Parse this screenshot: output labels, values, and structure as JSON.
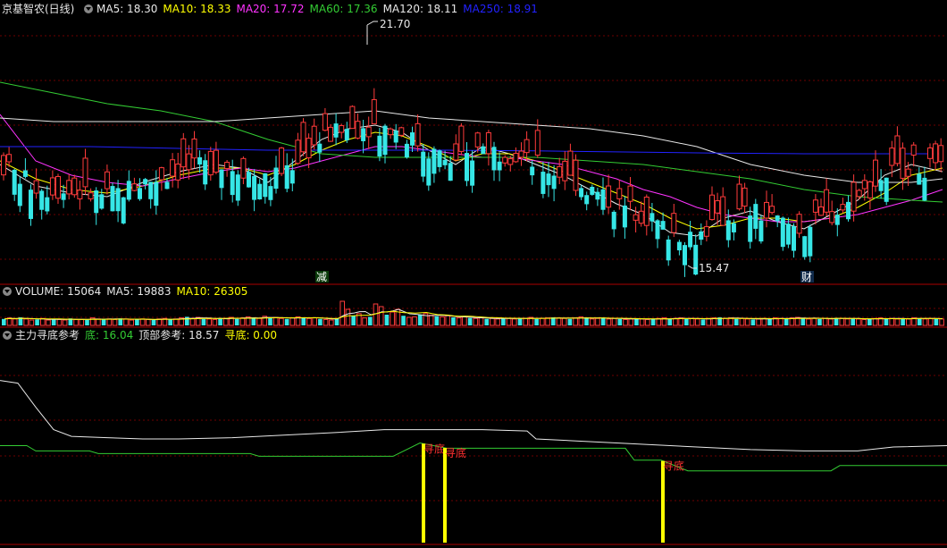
{
  "colors": {
    "background": "#000000",
    "frame": "#aa0000",
    "grid": "#6e0000",
    "up": "#ff3b3b",
    "down": "#36e6e6",
    "white_line": "#e8e8e8",
    "yellow": "#ffff00",
    "magenta": "#ff33ff",
    "green": "#33cc33",
    "blue": "#2222ff",
    "label_text": "#e8e8e8"
  },
  "price_panel": {
    "stock_name": "京基智农(日线)",
    "indicators": [
      {
        "label": "MA5: 18.30",
        "color": "#e8e8e8"
      },
      {
        "label": "MA10: 18.33",
        "color": "#ffff00"
      },
      {
        "label": "MA20: 17.72",
        "color": "#ff33ff"
      },
      {
        "label": "MA60: 17.36",
        "color": "#33cc33"
      },
      {
        "label": "MA120: 18.11",
        "color": "#e8e8e8"
      },
      {
        "label": "MA250: 18.91",
        "color": "#2222ff"
      }
    ],
    "high_label": "21.70",
    "low_label": "15.47",
    "marker_jian": "减",
    "marker_cai": "财"
  },
  "volume_panel": {
    "indicators": [
      {
        "label": "VOLUME: 15064",
        "color": "#e8e8e8"
      },
      {
        "label": "MA5: 19883",
        "color": "#e8e8e8"
      },
      {
        "label": "MA10: 26305",
        "color": "#ffff00"
      }
    ]
  },
  "indicator_panel": {
    "title": "主力寻底参考",
    "indicators": [
      {
        "label": "底: 16.04",
        "color": "#33cc33"
      },
      {
        "label": "顶部参考: 18.57",
        "color": "#e8e8e8"
      },
      {
        "label": "寻底: 0.00",
        "color": "#ffff00"
      }
    ],
    "signal_text": "寻底",
    "signals": [
      {
        "x": 474,
        "label": "寻底"
      },
      {
        "x": 498,
        "label": "寻底"
      },
      {
        "x": 742,
        "label": "寻底"
      }
    ]
  },
  "chart_data": [
    {
      "type": "candlestick",
      "ylim": [
        15.0,
        22.0
      ],
      "series": [
        {
          "name": "MA5",
          "color": "#e8e8e8",
          "points": [
            [
              0,
              17.9
            ],
            [
              40,
              17.3
            ],
            [
              80,
              17.1
            ],
            [
              120,
              17.0
            ],
            [
              160,
              17.4
            ],
            [
              200,
              17.7
            ],
            [
              240,
              17.9
            ],
            [
              270,
              17.8
            ],
            [
              300,
              17.4
            ],
            [
              330,
              18.0
            ],
            [
              360,
              18.6
            ],
            [
              390,
              18.9
            ],
            [
              420,
              19.0
            ],
            [
              450,
              18.8
            ],
            [
              480,
              18.3
            ],
            [
              510,
              17.9
            ],
            [
              540,
              18.4
            ],
            [
              570,
              18.2
            ],
            [
              600,
              17.9
            ],
            [
              630,
              17.6
            ],
            [
              660,
              17.2
            ],
            [
              690,
              16.8
            ],
            [
              720,
              16.5
            ],
            [
              750,
              16.0
            ],
            [
              780,
              15.9
            ],
            [
              810,
              16.4
            ],
            [
              840,
              16.6
            ],
            [
              870,
              16.3
            ],
            [
              900,
              16.1
            ],
            [
              930,
              16.5
            ],
            [
              960,
              16.9
            ],
            [
              990,
              17.6
            ],
            [
              1020,
              17.9
            ],
            [
              1055,
              17.7
            ]
          ]
        },
        {
          "name": "MA10",
          "color": "#ffff00",
          "points": [
            [
              0,
              18.0
            ],
            [
              40,
              17.5
            ],
            [
              80,
              17.2
            ],
            [
              120,
              17.1
            ],
            [
              160,
              17.3
            ],
            [
              200,
              17.6
            ],
            [
              240,
              17.8
            ],
            [
              270,
              17.8
            ],
            [
              300,
              17.6
            ],
            [
              330,
              17.9
            ],
            [
              360,
              18.3
            ],
            [
              390,
              18.6
            ],
            [
              420,
              18.8
            ],
            [
              450,
              18.7
            ],
            [
              480,
              18.4
            ],
            [
              510,
              18.0
            ],
            [
              540,
              18.2
            ],
            [
              570,
              18.2
            ],
            [
              600,
              18.0
            ],
            [
              630,
              17.7
            ],
            [
              660,
              17.4
            ],
            [
              690,
              17.1
            ],
            [
              720,
              16.8
            ],
            [
              750,
              16.4
            ],
            [
              780,
              16.1
            ],
            [
              810,
              16.2
            ],
            [
              840,
              16.4
            ],
            [
              870,
              16.4
            ],
            [
              900,
              16.3
            ],
            [
              930,
              16.4
            ],
            [
              960,
              16.7
            ],
            [
              990,
              17.1
            ],
            [
              1020,
              17.6
            ],
            [
              1055,
              17.8
            ]
          ]
        },
        {
          "name": "MA20",
          "color": "#ff33ff",
          "points": [
            [
              0,
              19.3
            ],
            [
              40,
              18.0
            ],
            [
              80,
              17.6
            ],
            [
              120,
              17.4
            ],
            [
              160,
              17.3
            ],
            [
              200,
              17.5
            ],
            [
              240,
              17.7
            ],
            [
              270,
              17.8
            ],
            [
              300,
              17.7
            ],
            [
              330,
              17.8
            ],
            [
              360,
              18.0
            ],
            [
              390,
              18.2
            ],
            [
              420,
              18.4
            ],
            [
              450,
              18.4
            ],
            [
              480,
              18.3
            ],
            [
              510,
              18.2
            ],
            [
              540,
              18.1
            ],
            [
              570,
              18.1
            ],
            [
              600,
              18.0
            ],
            [
              630,
              17.9
            ],
            [
              660,
              17.7
            ],
            [
              690,
              17.5
            ],
            [
              720,
              17.2
            ],
            [
              750,
              17.0
            ],
            [
              780,
              16.7
            ],
            [
              810,
              16.5
            ],
            [
              840,
              16.4
            ],
            [
              870,
              16.3
            ],
            [
              900,
              16.3
            ],
            [
              930,
              16.4
            ],
            [
              960,
              16.5
            ],
            [
              990,
              16.7
            ],
            [
              1020,
              16.9
            ],
            [
              1055,
              17.2
            ]
          ]
        },
        {
          "name": "MA60",
          "color": "#33cc33",
          "points": [
            [
              0,
              20.2
            ],
            [
              60,
              19.9
            ],
            [
              120,
              19.6
            ],
            [
              180,
              19.4
            ],
            [
              240,
              19.1
            ],
            [
              300,
              18.6
            ],
            [
              360,
              18.2
            ],
            [
              420,
              18.1
            ],
            [
              480,
              18.1
            ],
            [
              540,
              18.1
            ],
            [
              600,
              18.1
            ],
            [
              660,
              18.0
            ],
            [
              720,
              17.9
            ],
            [
              780,
              17.7
            ],
            [
              840,
              17.5
            ],
            [
              900,
              17.2
            ],
            [
              960,
              17.0
            ],
            [
              1020,
              16.9
            ],
            [
              1055,
              16.85
            ]
          ]
        },
        {
          "name": "MA120",
          "color": "#e8e8e8",
          "points": [
            [
              0,
              19.2
            ],
            [
              60,
              19.1
            ],
            [
              120,
              19.1
            ],
            [
              180,
              19.1
            ],
            [
              240,
              19.1
            ],
            [
              300,
              19.2
            ],
            [
              360,
              19.3
            ],
            [
              420,
              19.4
            ],
            [
              480,
              19.2
            ],
            [
              540,
              19.1
            ],
            [
              600,
              19.0
            ],
            [
              660,
              18.9
            ],
            [
              720,
              18.7
            ],
            [
              780,
              18.4
            ],
            [
              840,
              17.9
            ],
            [
              900,
              17.6
            ],
            [
              960,
              17.4
            ],
            [
              1020,
              17.4
            ],
            [
              1055,
              17.5
            ]
          ]
        },
        {
          "name": "MA250",
          "color": "#2222ff",
          "points": [
            [
              0,
              18.4
            ],
            [
              100,
              18.4
            ],
            [
              200,
              18.35
            ],
            [
              300,
              18.3
            ],
            [
              400,
              18.3
            ],
            [
              500,
              18.3
            ],
            [
              600,
              18.28
            ],
            [
              700,
              18.25
            ],
            [
              800,
              18.22
            ],
            [
              900,
              18.2
            ],
            [
              1000,
              18.2
            ],
            [
              1055,
              18.2
            ]
          ]
        }
      ],
      "low_index": 26,
      "high_index": 12
    },
    {
      "type": "bar",
      "ylim": [
        0,
        100000
      ],
      "series": [
        {
          "name": "VOLUME",
          "values": [
            12,
            14,
            12,
            15,
            12,
            10,
            11,
            13,
            10,
            12,
            11,
            10,
            13,
            11,
            11,
            10,
            14,
            12,
            11,
            12,
            11,
            13,
            12,
            10,
            11,
            12,
            11,
            10,
            12,
            13,
            11,
            12,
            14,
            16,
            13,
            15,
            12,
            12,
            11,
            14,
            13,
            15,
            12,
            14,
            16,
            14,
            13,
            17,
            14,
            15,
            13,
            12,
            14,
            16,
            15,
            13,
            14,
            12,
            11,
            10,
            13,
            45,
            30,
            18,
            22,
            14,
            16,
            40,
            35,
            20,
            25,
            30,
            18,
            15,
            16,
            20,
            22,
            19,
            17,
            16,
            18,
            15,
            14,
            16,
            14,
            13,
            14,
            12,
            13,
            12,
            14,
            13,
            12,
            14,
            13,
            15,
            12,
            13,
            14,
            15,
            14,
            13,
            12,
            14,
            16,
            15,
            12,
            13,
            14,
            12,
            13,
            12,
            11,
            12,
            13,
            12,
            11,
            12,
            13,
            14,
            12,
            13,
            14,
            12,
            13,
            12,
            11,
            13,
            14,
            15,
            13,
            14,
            12,
            13,
            12,
            11,
            12,
            13,
            12,
            14,
            13,
            12,
            14,
            15,
            14,
            12,
            13,
            12,
            13,
            12,
            14,
            13,
            12,
            13,
            12,
            11,
            12,
            13,
            14,
            12,
            13,
            12,
            13,
            12,
            14,
            13,
            12,
            13,
            12,
            12
          ]
        }
      ]
    },
    {
      "type": "line",
      "ylim": [
        10,
        25
      ],
      "series": [
        {
          "name": "顶部参考",
          "color": "#e8e8e8",
          "points": [
            [
              0,
              22.2
            ],
            [
              20,
              22.0
            ],
            [
              40,
              20.2
            ],
            [
              60,
              18.5
            ],
            [
              80,
              18.0
            ],
            [
              120,
              17.9
            ],
            [
              160,
              17.8
            ],
            [
              200,
              17.8
            ],
            [
              260,
              17.9
            ],
            [
              320,
              18.1
            ],
            [
              380,
              18.3
            ],
            [
              430,
              18.5
            ],
            [
              480,
              18.5
            ],
            [
              540,
              18.5
            ],
            [
              590,
              18.4
            ],
            [
              600,
              17.8
            ],
            [
              660,
              17.6
            ],
            [
              720,
              17.4
            ],
            [
              780,
              17.2
            ],
            [
              840,
              17.0
            ],
            [
              900,
              16.9
            ],
            [
              960,
              16.9
            ],
            [
              1000,
              17.2
            ],
            [
              1060,
              17.3
            ]
          ]
        },
        {
          "name": "底",
          "color": "#33cc33",
          "points": [
            [
              0,
              17.3
            ],
            [
              30,
              17.3
            ],
            [
              40,
              16.9
            ],
            [
              100,
              16.9
            ],
            [
              110,
              16.7
            ],
            [
              280,
              16.7
            ],
            [
              290,
              16.5
            ],
            [
              440,
              16.5
            ],
            [
              470,
              17.5
            ],
            [
              500,
              17.1
            ],
            [
              600,
              17.1
            ],
            [
              700,
              17.1
            ],
            [
              710,
              16.2
            ],
            [
              740,
              16.2
            ],
            [
              770,
              15.4
            ],
            [
              930,
              15.4
            ],
            [
              940,
              15.8
            ],
            [
              1060,
              15.8
            ]
          ]
        }
      ]
    }
  ]
}
